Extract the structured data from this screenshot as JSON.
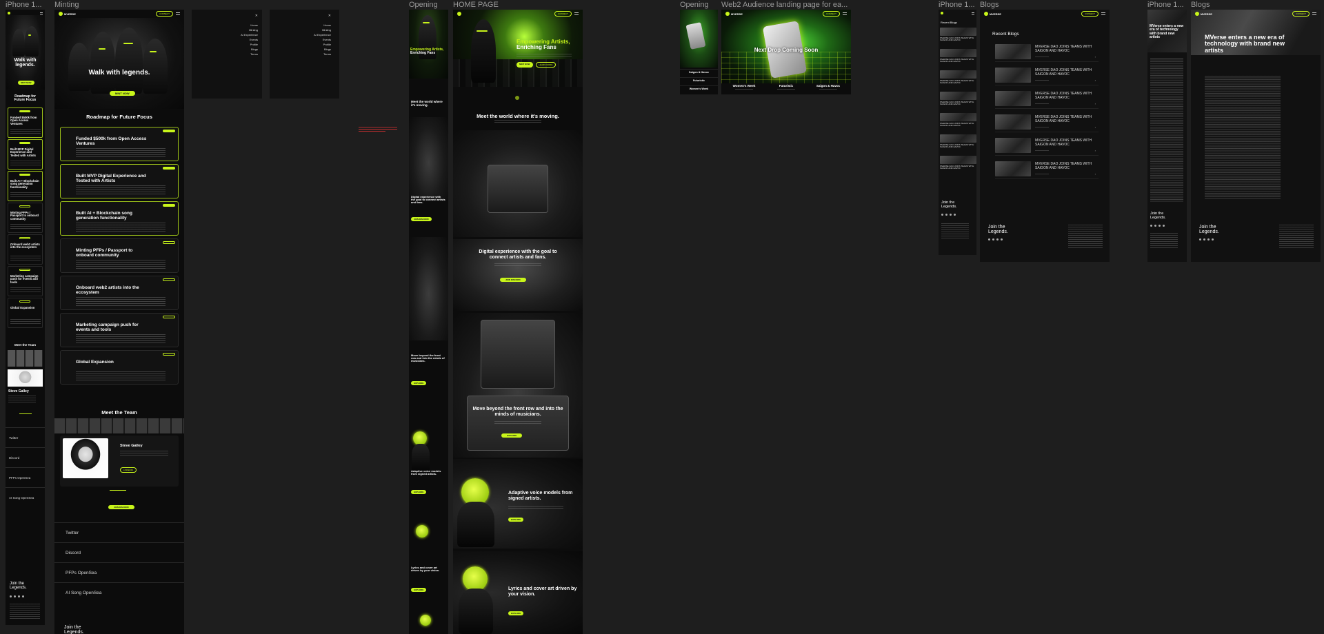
{
  "labels": {
    "iphone1": "iPhone 1...",
    "minting": "Minting",
    "opening1": "Opening",
    "homepage": "HOME PAGE",
    "opening2": "Opening",
    "web2": "Web2 Audience landing page for ea...",
    "iphone2": "iPhone 1...",
    "blogs1": "Blogs",
    "iphone3": "iPhone 1...",
    "blogs2": "Blogs"
  },
  "colors": {
    "accent": "#c8f51a",
    "canvas": "#1e1e1e",
    "frame_bg": "#0c0c0c"
  },
  "minting": {
    "hero_title": "Walk with legends.",
    "roadmap_title": "Roadmap for Future Focus",
    "roadmap": [
      {
        "title": "Funded $500k from Open Access Ventures",
        "active": true
      },
      {
        "title": "Built MVP Digital Experience and Tested with Artists",
        "active": true
      },
      {
        "title": "Built AI + Blockchain song generation functionality",
        "active": true
      },
      {
        "title": "Minting PFPs / Passport to onboard community",
        "active": false
      },
      {
        "title": "Onboard web2 artists into the ecosystem",
        "active": false
      },
      {
        "title": "Marketing campaign push for events and tools",
        "active": false
      },
      {
        "title": "Global Expansion",
        "active": false
      }
    ],
    "team_title": "Meet the Team",
    "member_name": "Steve Galley",
    "footer_links": [
      "Twitter",
      "Discord",
      "PFPs OpenSea",
      "AI Song OpenSea"
    ],
    "join": "Join the Legends."
  },
  "mobile_minting": {
    "hero_title": "Walk with legends.",
    "roadmap_title": "Roadmap for Future Focus",
    "roadmap": [
      "Funded $500k from Open Access Ventures",
      "Built MVP Digital Experience and Tested with Artists",
      "Built AI + Blockchain song generation functionality",
      "Minting PFPs / Passport to onboard community",
      "Onboard web2 artists into the ecosystem",
      "Marketing campaign push for events and tools",
      "Global Expansion"
    ],
    "team_title": "Meet the Team",
    "member_name": "Steve Galley",
    "footer_links": [
      "Twitter",
      "Discord",
      "PFPs OpenSea",
      "AI Song OpenSea"
    ],
    "join": "Join the Legends."
  },
  "menu": [
    "Home",
    "Minting",
    "AI Experience",
    "Events",
    "Profile",
    "Blogs",
    "Terms"
  ],
  "home": {
    "hero_line1": "Empowering Artists,",
    "hero_line2": "Enriching Fans",
    "sections": [
      "Meet the world where it's moving.",
      "Digital experience with the goal to connect artists and fans.",
      "Move beyond the front row and into the minds of musicians.",
      "Adaptive voice models from signed artists.",
      "Lyrics and cover art driven by your vision."
    ]
  },
  "web2": {
    "hero_title": "Next Drop Coming Soon",
    "cards": [
      {
        "title": "Women's Week"
      },
      {
        "title": "Futuristic"
      },
      {
        "title": "Saigon & Havoc"
      }
    ],
    "mobile_cards": [
      "Saigon & Havoc",
      "Futuristic",
      "Women's Week"
    ]
  },
  "blogs": {
    "title": "Recent Blogs",
    "item": "MVERSE DAO JOINS TEAMS WITH SAIGON AND HAVOC",
    "join": "Join the Legends."
  },
  "article": {
    "headline": "MVerse enters a new era of technology with brand new artists",
    "join": "Join the Legends."
  }
}
